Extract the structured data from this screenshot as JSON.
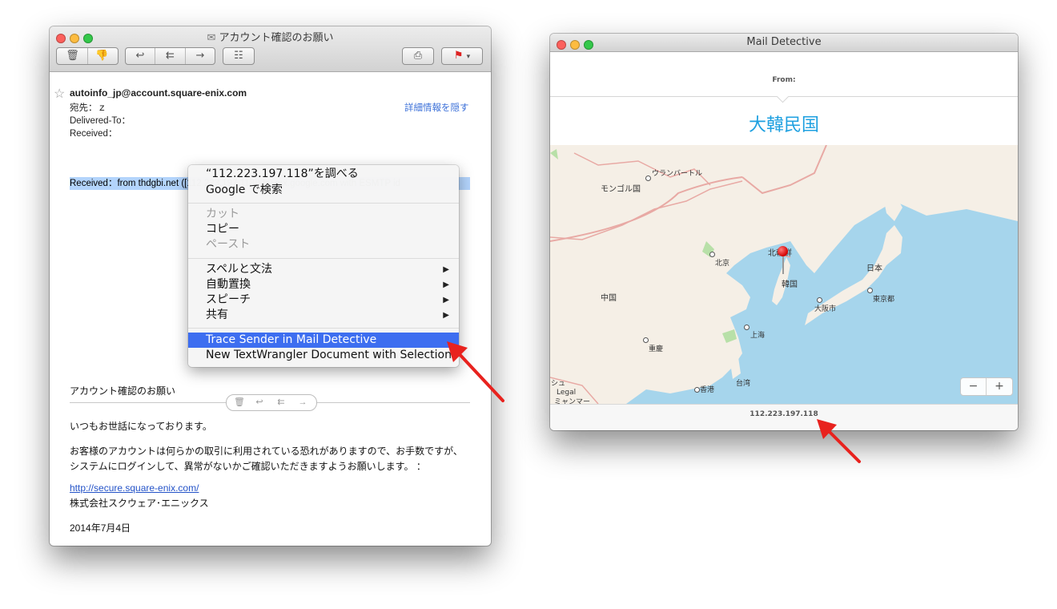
{
  "mail_window": {
    "title": "アカウント確認のお願い",
    "from": "autoinfo_jp@account.square-enix.com",
    "to_label": "宛先：",
    "to_value": "ｚ",
    "delivered_to_label": "Delivered-To：",
    "received_label": "Received：",
    "hide_details_link": "詳細情報を隠す",
    "selected_header": "Received：from thdgbi.net ([112.223.197.118]) by mx.google.com with ESMTP id",
    "subject_line": "アカウント確認のお願い",
    "body_greeting": "いつもお世話になっております。",
    "body_para_1": "お客様のアカウントは何らかの取引に利用されている恐れがありますので、お手数ですが、",
    "body_para_2": "システムにログインして、異常がないかご確認いただきますようお願いします。 ：",
    "link": "http://secure.square-enix.com/",
    "company": "株式会社スクウェア･エニックス",
    "date": "2014年7月4日",
    "toolbar_icons": [
      "trash-icon",
      "junk-icon",
      "reply-icon",
      "reply-all-icon",
      "forward-icon",
      "contact-icon",
      "print-icon",
      "flag-icon"
    ],
    "inline_toolbar_icons": [
      "trash-icon",
      "reply-icon",
      "reply-all-icon",
      "forward-icon"
    ]
  },
  "context_menu": {
    "items": [
      {
        "label": "“112.223.197.118”を調べる",
        "enabled": true
      },
      {
        "label": "Google で検索",
        "enabled": true
      },
      {
        "label": "カット",
        "enabled": false
      },
      {
        "label": "コピー",
        "enabled": true
      },
      {
        "label": "ペースト",
        "enabled": false
      },
      {
        "label": "スペルと文法",
        "enabled": true,
        "submenu": true
      },
      {
        "label": "自動置換",
        "enabled": true,
        "submenu": true
      },
      {
        "label": "スピーチ",
        "enabled": true,
        "submenu": true
      },
      {
        "label": "共有",
        "enabled": true,
        "submenu": true
      },
      {
        "label": "Trace Sender in Mail Detective",
        "enabled": true,
        "highlighted": true
      },
      {
        "label": "New TextWrangler Document with Selection",
        "enabled": true
      }
    ],
    "submenu_arrow": "▶",
    "highlight_color": "#3d6ef0"
  },
  "detective_window": {
    "title": "Mail Detective",
    "from_label": "From:",
    "country": "大韓民国",
    "country_color": "#1ea0e0",
    "ip": "112.223.197.118",
    "map_labels": {
      "ulaanbaatar": "ウランバートル",
      "mongolia": "モンゴル国",
      "beijing": "北京",
      "north": "北朝鮮",
      "korea": "韓国",
      "japan": "日本",
      "tokyo": "東京都",
      "osaka": "大阪市",
      "china": "中国",
      "shanghai": "上海",
      "chongqing": "重慶",
      "taiwan": "台湾",
      "hongkong": "香港",
      "legal": "Legal",
      "myanmar": "ミャンマー",
      "shu": "シュ"
    },
    "zoom_out": "−",
    "zoom_in": "+"
  },
  "colors": {
    "arrow": "#e8221e",
    "sea": "#a6d5ec",
    "land": "#f5efe6",
    "border": "#e8a9a4"
  }
}
